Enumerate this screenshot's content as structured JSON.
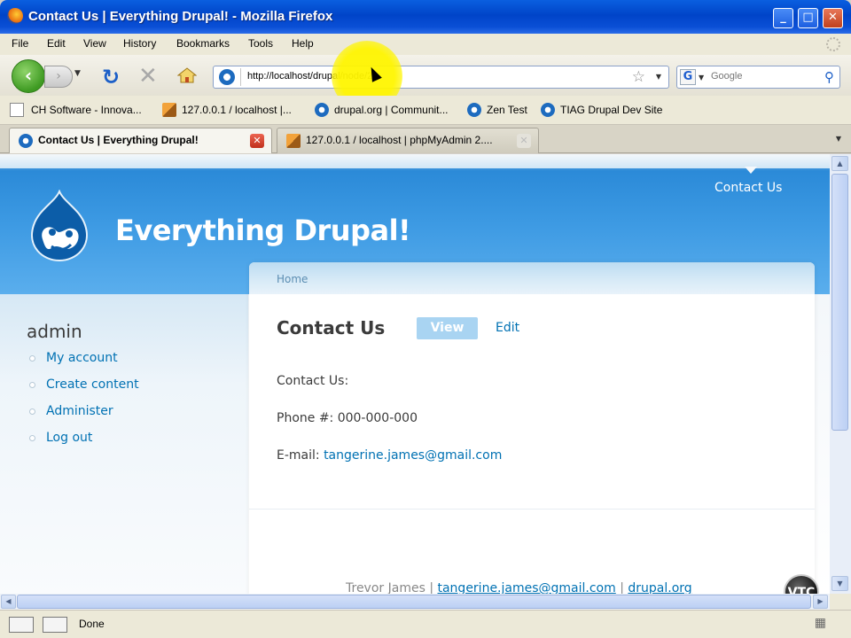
{
  "window": {
    "title": "Contact Us | Everything Drupal! - Mozilla Firefox",
    "controls": {
      "minimize": "_",
      "maximize": "□",
      "close": "✕"
    }
  },
  "menu": [
    "File",
    "Edit",
    "View",
    "History",
    "Bookmarks",
    "Tools",
    "Help"
  ],
  "navigation": {
    "url": "http://localhost/drupal/node/2",
    "search_placeholder": "Google",
    "search_engine_letter": "G"
  },
  "bookmarks": [
    {
      "label": "CH Software - Innova...",
      "icon": "document-icon"
    },
    {
      "label": "127.0.0.1 / localhost |...",
      "icon": "phpmyadmin-icon"
    },
    {
      "label": "drupal.org | Communit...",
      "icon": "ie-page-icon"
    },
    {
      "label": "Zen Test",
      "icon": "ie-page-icon"
    },
    {
      "label": "TIAG Drupal Dev Site",
      "icon": "ie-page-icon"
    }
  ],
  "tabs": [
    {
      "label": "Contact Us | Everything Drupal!",
      "active": true
    },
    {
      "label": "127.0.0.1 / localhost | phpMyAdmin 2....",
      "active": false
    }
  ],
  "site": {
    "name": "Everything Drupal!",
    "primary_link": "Contact Us"
  },
  "sidebar": {
    "heading": "admin",
    "links": [
      "My account",
      "Create content",
      "Administer",
      "Log out"
    ]
  },
  "main": {
    "breadcrumb": "Home",
    "title": "Contact Us",
    "tab_view": "View",
    "tab_edit": "Edit",
    "contact_label": "Contact Us:",
    "phone": "Phone #: 000-000-000",
    "email_label": "E-mail: ",
    "email": "tangerine.james@gmail.com"
  },
  "footer": {
    "author": "Trevor James | ",
    "email": "tangerine.james@gmail.com",
    "separator": " | ",
    "site": "drupal.org"
  },
  "watermark": "VTC",
  "status": {
    "text": "Done"
  }
}
